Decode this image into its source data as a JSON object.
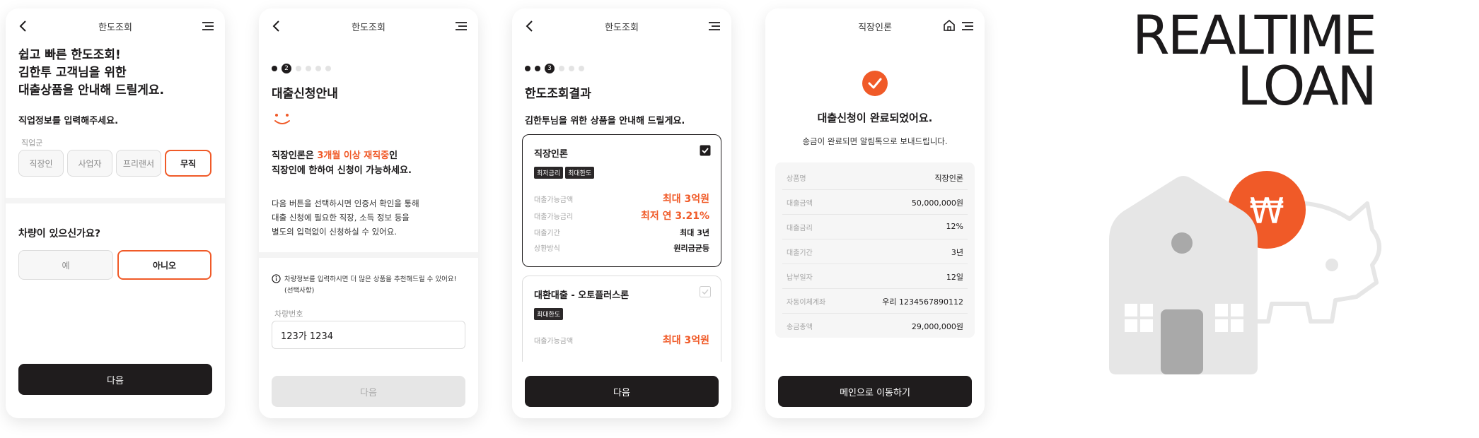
{
  "screen1": {
    "title": "한도조회",
    "heading": [
      "쉽고 빠른 한도조회!",
      "김한투 고객님을 위한",
      "대출상품을 안내해 드릴게요."
    ],
    "subheading": "직업정보를 입력해주세요.",
    "job_label": "직업군",
    "jobs": [
      "직장인",
      "사업자",
      "프리랜서",
      "무직"
    ],
    "job_selected": "무직",
    "car_question": "차량이 있으신가요?",
    "car_options": [
      "예",
      "아니오"
    ],
    "car_selected": "아니오",
    "next_label": "다음"
  },
  "screen2": {
    "title": "한도조회",
    "step_current": "2",
    "heading": "대출신청안내",
    "notice_prefix": "직장인론은 ",
    "notice_highlight": "3개월 이상 재직중",
    "notice_suffix": "인",
    "notice_line2": "직장인에 한하여 신청이 가능하세요.",
    "desc": [
      "다음 버튼을 선택하시면 인증서 확인을 통해",
      "대출 신청에 필요한 직장, 소득 정보 등을",
      "별도의 입력없이 신청하실 수 있어요."
    ],
    "info_text": [
      "차량정보를 입력하시면 더 많은 상품을 추천해드릴 수 있어요!",
      "(선택사항)"
    ],
    "car_number_label": "차량번호",
    "car_number_value": "123가 1234",
    "next_label": "다음"
  },
  "screen3": {
    "title": "한도조회",
    "step_current": "3",
    "heading": "한도조회결과",
    "subheading": "김한투님을 위한 상품을 안내해 드릴게요.",
    "product1": {
      "name": "직장인론",
      "tags": [
        "최저금리",
        "최대한도"
      ],
      "rows": [
        {
          "k": "대출가능금액",
          "v": "최대 3억원",
          "big": true
        },
        {
          "k": "대출가능금리",
          "v": "최저 연 3.21%",
          "big": true
        },
        {
          "k": "대출기간",
          "v": "최대 3년",
          "big": false
        },
        {
          "k": "상환방식",
          "v": "원리금균등",
          "big": false
        }
      ]
    },
    "product2": {
      "name": "대환대출 - 오토플러스론",
      "tags": [
        "최대한도"
      ],
      "rows": [
        {
          "k": "대출가능금액",
          "v": "최대 3억원",
          "big": true
        }
      ]
    },
    "next_label": "다음"
  },
  "screen4": {
    "title": "직장인론",
    "heading": "대출신청이 완료되었어요.",
    "subheading": "송금이 완료되면 알림톡으로 보내드립니다.",
    "summary": [
      {
        "k": "상품명",
        "v": "직장인론"
      },
      {
        "k": "대출금액",
        "v": "50,000,000원"
      },
      {
        "k": "대출금리",
        "v": "12%"
      },
      {
        "k": "대출기간",
        "v": "3년"
      },
      {
        "k": "납부일자",
        "v": "12일"
      },
      {
        "k": "자동이체계좌",
        "v": "우리 1234567890112"
      },
      {
        "k": "송금총액",
        "v": "29,000,000원"
      }
    ],
    "main_button": "메인으로 이동하기"
  },
  "brand": {
    "line1": "REALTIME",
    "line2": "LOAN",
    "currency_symbol": "₩"
  },
  "colors": {
    "accent": "#f05a28",
    "dark": "#1f1c1d",
    "illustration_gray": "#e6e6e6"
  }
}
